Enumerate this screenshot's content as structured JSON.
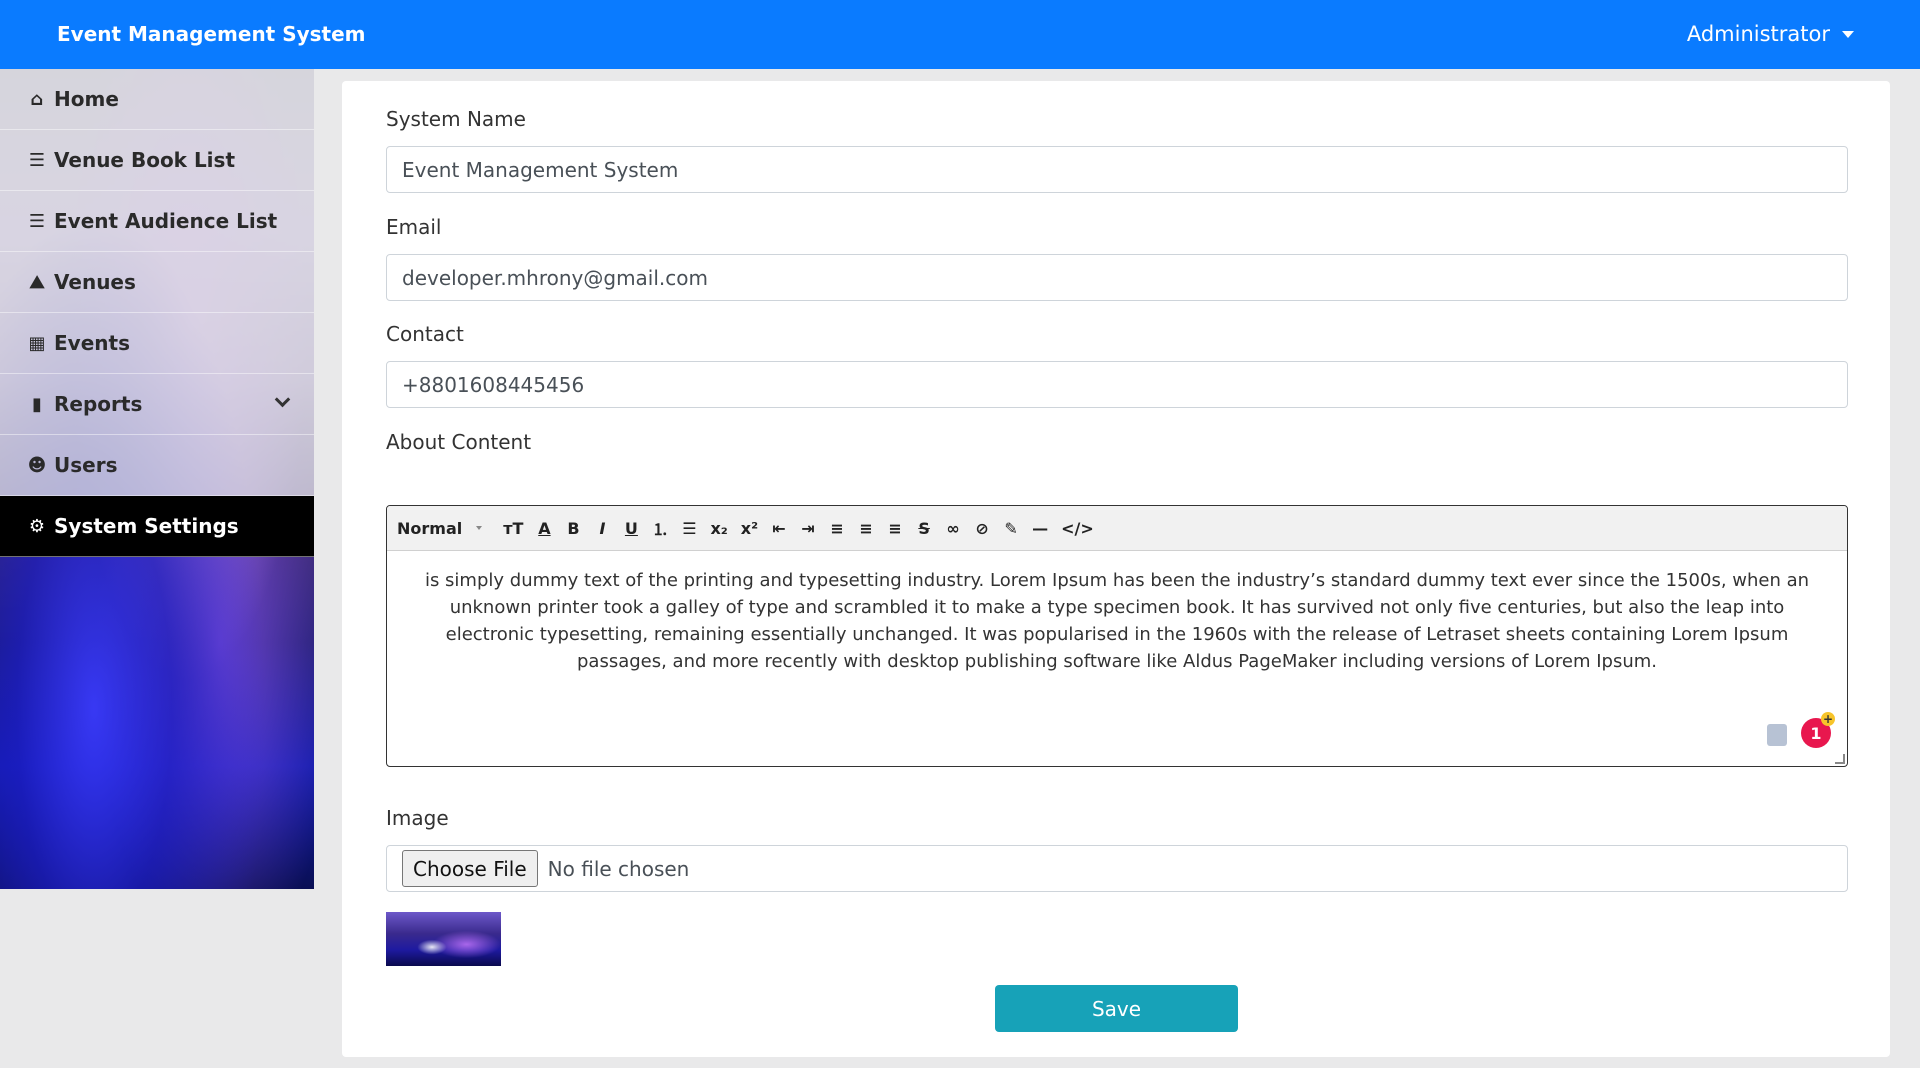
{
  "navbar": {
    "brand": "Event Management System",
    "user_label": "Administrator"
  },
  "sidebar": {
    "items": [
      {
        "label": "Home",
        "icon": "home-icon"
      },
      {
        "label": "Venue Book List",
        "icon": "list-icon"
      },
      {
        "label": "Event Audience List",
        "icon": "list-icon"
      },
      {
        "label": "Venues",
        "icon": "map-icon"
      },
      {
        "label": "Events",
        "icon": "calendar-icon"
      },
      {
        "label": "Reports",
        "icon": "file-icon"
      },
      {
        "label": "Users",
        "icon": "users-icon"
      },
      {
        "label": "System Settings",
        "icon": "cogs-icon",
        "active": true
      }
    ]
  },
  "form": {
    "system_name_label": "System Name",
    "system_name_value": "Event Management System",
    "email_label": "Email",
    "email_value": "developer.mhrony@gmail.com",
    "contact_label": "Contact",
    "contact_value": "+8801608445456",
    "about_label": "About Content",
    "image_label": "Image",
    "choose_file_label": "Choose File",
    "no_file_text": "No file chosen",
    "save_label": "Save"
  },
  "editor": {
    "style_dropdown": "Normal",
    "content": "is simply dummy text of the printing and typesetting industry. Lorem Ipsum has been the industry’s standard dummy text ever since the 1500s, when an unknown printer took a galley of type and scrambled it to make a type specimen book. It has survived not only five centuries, but also the leap into electronic typesetting, remaining essentially unchanged. It was popularised in the 1960s with the release of Letraset sheets containing Lorem Ipsum passages, and more recently with desktop publishing software like Aldus PageMaker including versions of Lorem Ipsum.",
    "badge_count": "1"
  },
  "colors": {
    "navbar": "#0a7bff",
    "save_button": "#17a2b8",
    "active_sidebar": "#000000",
    "badge": "#e8174e"
  }
}
